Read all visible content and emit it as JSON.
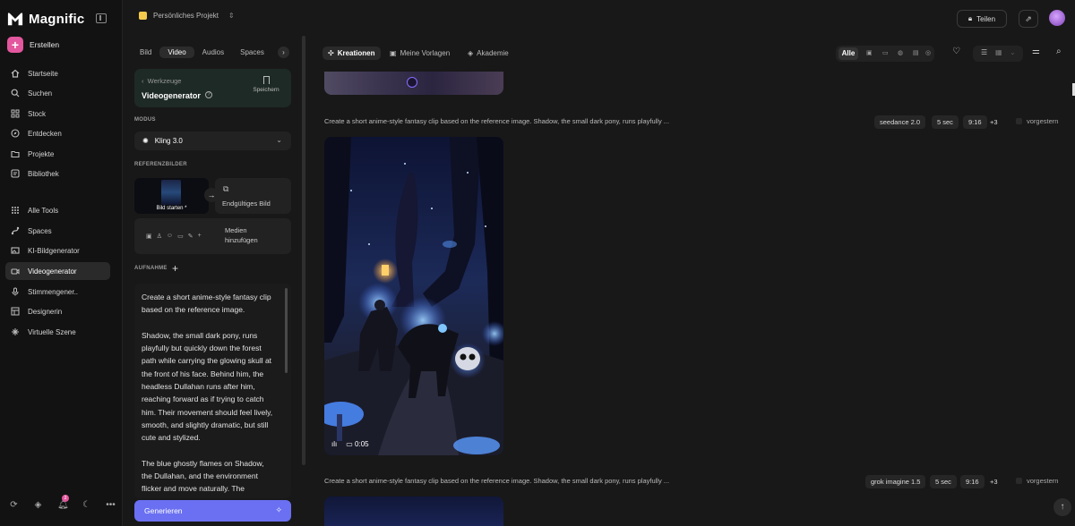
{
  "sidebar": {
    "brand": "Magnific",
    "create_label": "Erstellen",
    "nav_main": [
      {
        "label": "Startseite",
        "icon": "home-icon"
      },
      {
        "label": "Suchen",
        "icon": "search-icon"
      },
      {
        "label": "Stock",
        "icon": "grid-icon"
      },
      {
        "label": "Entdecken",
        "icon": "compass-icon"
      },
      {
        "label": "Projekte",
        "icon": "folder-icon"
      },
      {
        "label": "Bibliothek",
        "icon": "library-icon"
      }
    ],
    "nav_tools": [
      {
        "label": "Alle Tools",
        "icon": "apps-icon"
      },
      {
        "label": "Spaces",
        "icon": "spaces-icon"
      },
      {
        "label": "KI-Bildgenerator",
        "icon": "image-icon"
      },
      {
        "label": "Videogenerator",
        "icon": "video-icon",
        "active": true
      },
      {
        "label": "Stimmengener..",
        "icon": "mic-icon"
      },
      {
        "label": "Designerin",
        "icon": "design-icon"
      },
      {
        "label": "Virtuelle Szene",
        "icon": "scene-icon"
      }
    ],
    "notification_count": "2"
  },
  "topbar": {
    "project_name": "Persönliches Projekt",
    "share_label": "Teilen"
  },
  "panel": {
    "tabs": [
      "Bild",
      "Video",
      "Audios",
      "Spaces"
    ],
    "active_tab": "Video",
    "back_label": "Werkzeuge",
    "tool_name": "Videogenerator",
    "save_label": "Speichern",
    "mode_section": "MODUS",
    "mode_value": "Kling 3.0",
    "ref_section": "REFERENZBILDER",
    "ref_start_label": "Bild starten *",
    "ref_end_label": "Endgültiges Bild",
    "media_label": "Medien hinzufügen",
    "record_section": "AUFNAHME",
    "prompt_text": "Create a short anime-style fantasy clip based on the reference image.\n\nShadow, the small dark pony, runs playfully but quickly down the forest path while carrying the glowing skull at the front of his face. Behind him, the headless Dullahan runs after him, reaching forward as if trying to catch him. Their movement should feel lively, smooth, and slightly dramatic, but still cute and stylized.\n\nThe blue ghostly flames on Shadow, the Dullahan, and the environment flicker and move naturally. The",
    "generate_label": "Generieren"
  },
  "main": {
    "tabs": [
      {
        "label": "Kreationen",
        "icon": "sparkle-icon",
        "active": true
      },
      {
        "label": "Meine Vorlagen",
        "icon": "template-icon"
      },
      {
        "label": "Akademie",
        "icon": "academy-icon"
      }
    ],
    "filter_all": "Alle",
    "rows": [
      {
        "prompt": "Create a short anime-style fantasy clip based on the reference image. Shadow, the small dark pony, runs playfully ...",
        "model": "seedance 2.0",
        "duration": "5 sec",
        "ratio": "9:16",
        "more": "+3",
        "date": "vorgestern",
        "video_time": "0:05"
      },
      {
        "prompt": "Create a short anime-style fantasy clip based on the reference image. Shadow, the small dark pony, runs playfully ...",
        "model": "grok imagine 1.5",
        "duration": "5 sec",
        "ratio": "9:16",
        "more": "+3",
        "date": "vorgestern"
      }
    ]
  }
}
